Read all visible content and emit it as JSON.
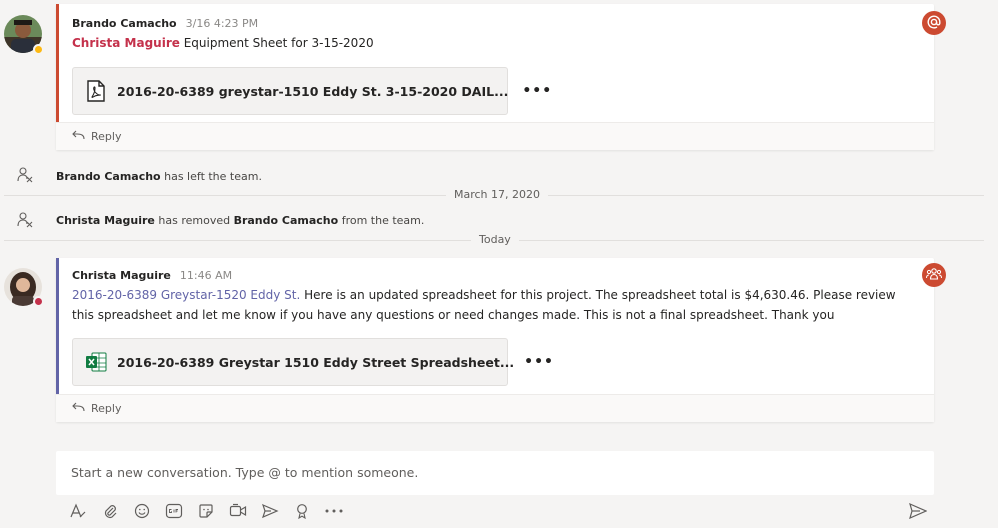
{
  "post1": {
    "author": "Brando Camacho",
    "time": "3/16 4:23 PM",
    "mention": "Christa Maguire",
    "text": " Equipment Sheet for 3-15-2020",
    "attachment": {
      "name": "2016-20-6389 greystar-1510 Eddy St. 3-15-2020 DAIL...",
      "type": "pdf-icon"
    },
    "more": "•••",
    "reply": "Reply",
    "accent_color": "#cc4a31"
  },
  "system": {
    "left": {
      "actor": "Brando Camacho",
      "text": " has left the team."
    },
    "date1": "March 17, 2020",
    "removed": {
      "actor": "Christa Maguire",
      "mid": " has removed ",
      "target": "Brando Camacho",
      "end": " from the team."
    },
    "date2": "Today"
  },
  "post2": {
    "author": "Christa Maguire",
    "time": "11:46 AM",
    "channel_link": "2016-20-6389 Greystar-1520 Eddy St.",
    "text": " Here is an updated spreadsheet for this project. The spreadsheet total is $4,630.46. Please review this spreadsheet and let me know if you have any questions or need changes made. This is not a final spreadsheet. Thank you",
    "attachment": {
      "name": "2016-20-6389 Greystar 1510 Eddy Street Spreadsheet...",
      "type": "excel-icon"
    },
    "more": "•••",
    "reply": "Reply",
    "accent_color": "#6264a7"
  },
  "composer": {
    "placeholder": "Start a new conversation. Type @ to mention someone."
  },
  "colors": {
    "mention": "#c4314b",
    "link": "#6264a7",
    "badge": "#cc4a31"
  }
}
